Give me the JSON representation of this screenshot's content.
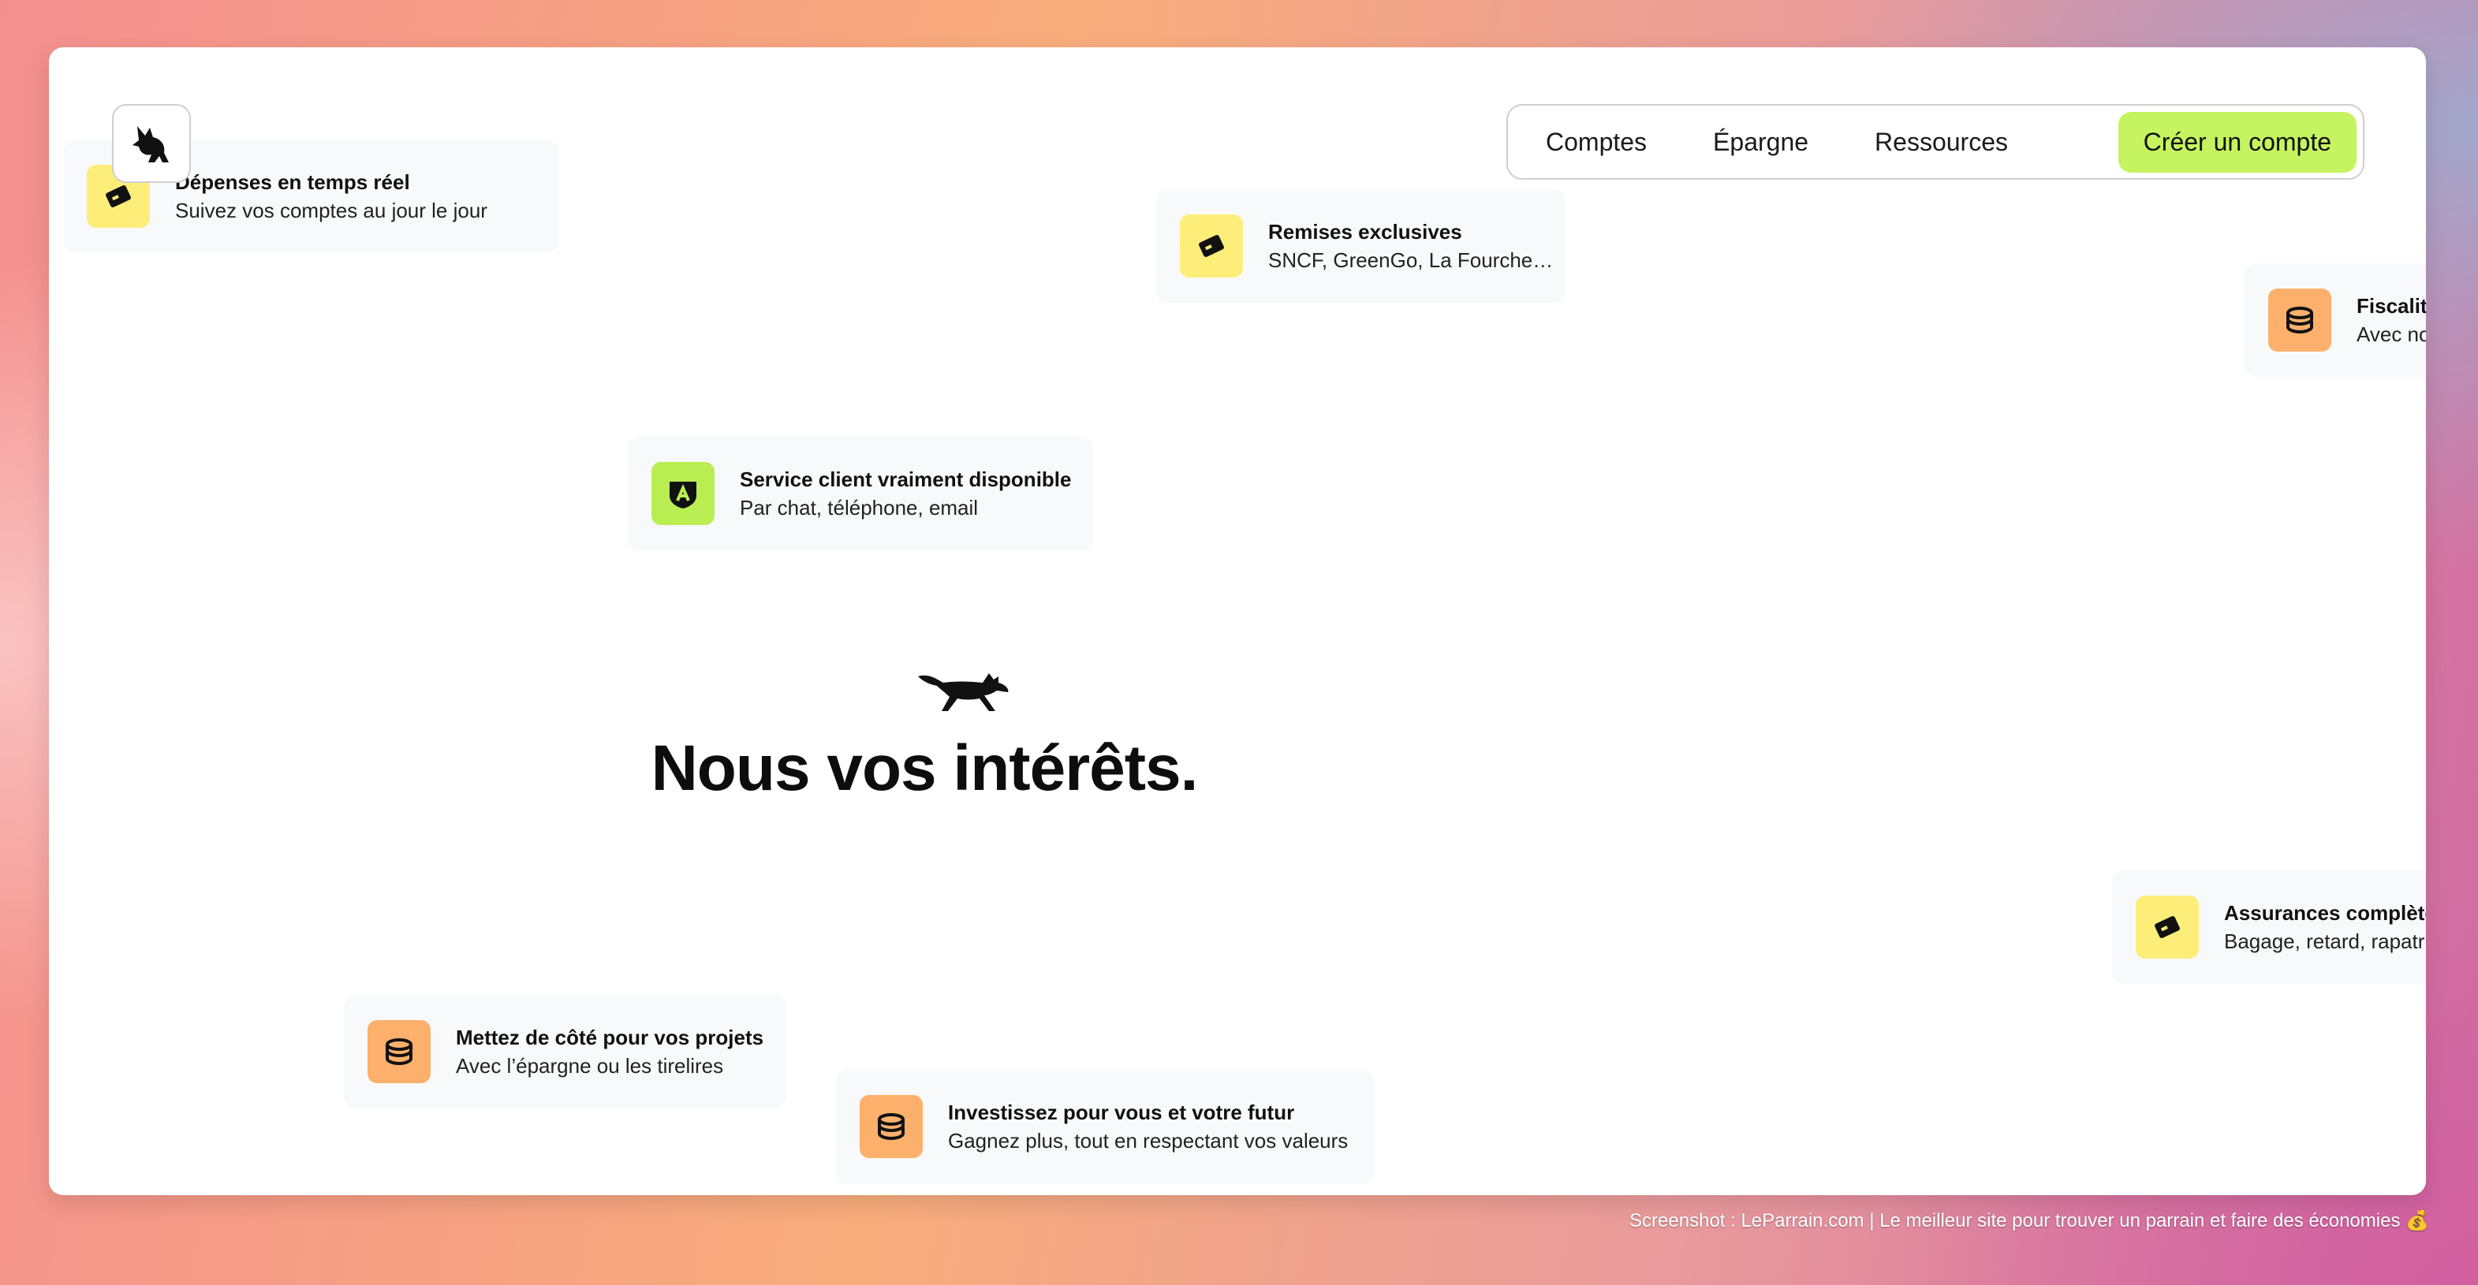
{
  "nav": {
    "items": [
      {
        "label": "Comptes"
      },
      {
        "label": "Épargne"
      },
      {
        "label": "Ressources"
      }
    ],
    "cta": "Créer un compte"
  },
  "cards": [
    {
      "title": "Dépenses en temps réel",
      "subtitle": "Suivez vos comptes au jour le jour",
      "icon": "card-icon",
      "color": "#fdee7a"
    },
    {
      "title": "Remises exclusives",
      "subtitle": "SNCF, GreenGo, La Fourche…",
      "icon": "card-icon",
      "color": "#fdee7a"
    },
    {
      "title": "Fiscalit",
      "subtitle": "Avec no",
      "icon": "coins-icon",
      "color": "#fcb06b"
    },
    {
      "title": "Service client vraiment disponible",
      "subtitle": "Par chat, téléphone, email",
      "icon": "shield-icon",
      "color": "#b9ee52"
    },
    {
      "title": "Assurances complète",
      "subtitle": "Bagage, retard, rapatri",
      "icon": "card-icon",
      "color": "#fdee7a"
    },
    {
      "title": "Mettez de côté pour vos projets",
      "subtitle": "Avec l’épargne ou les tirelires",
      "icon": "coins-icon",
      "color": "#fcb06b"
    },
    {
      "title": "Investissez pour vous et votre futur",
      "subtitle": "Gagnez plus, tout en respectant vos valeurs",
      "icon": "coins-icon",
      "color": "#fcb06b"
    }
  ],
  "hero": {
    "title": "Nous vos intérêts."
  },
  "footer": {
    "credit": "Screenshot : LeParrain.com | Le meilleur site pour trouver un parrain et faire des économies 💰"
  }
}
